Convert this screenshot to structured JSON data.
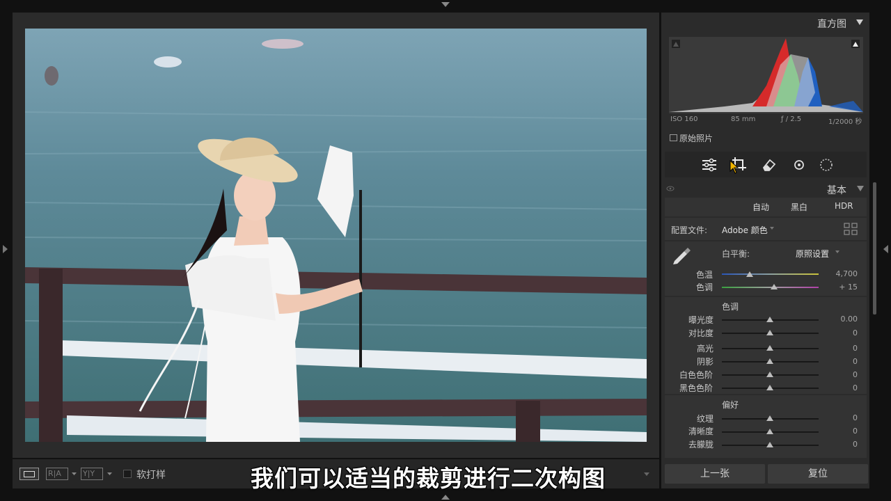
{
  "histogram": {
    "title": "直方图",
    "exif": {
      "iso": "ISO 160",
      "focal": "85 mm",
      "aperture": "ƒ / 2.5",
      "shutter": "1/2000 秒"
    },
    "original_photo_label": "原始照片"
  },
  "basic": {
    "title": "基本",
    "auto": "自动",
    "bw": "黑白",
    "hdr": "HDR",
    "profile_label": "配置文件:",
    "profile_value": "Adobe 颜色",
    "wb_label": "白平衡:",
    "wb_value": "原照设置",
    "temp_label": "色温",
    "temp_value": "4,700",
    "tint_label": "色调",
    "tint_value": "+ 15",
    "tone_header": "色调",
    "exposure_label": "曝光度",
    "exposure_value": "0.00",
    "contrast_label": "对比度",
    "contrast_value": "0",
    "highlights_label": "高光",
    "highlights_value": "0",
    "shadows_label": "阴影",
    "shadows_value": "0",
    "whites_label": "白色色阶",
    "whites_value": "0",
    "blacks_label": "黑色色阶",
    "blacks_value": "0",
    "presence_header": "偏好",
    "texture_label": "纹理",
    "texture_value": "0",
    "clarity_label": "清晰度",
    "clarity_value": "0",
    "dehaze_label": "去朦胧",
    "dehaze_value": "0"
  },
  "toolbar": {
    "soft_proof_label": "软打样",
    "view_ra": "R|A",
    "view_yy": "Y|Y"
  },
  "nav": {
    "prev_label": "上一张",
    "reset_label": "复位"
  },
  "subtitle": "我们可以适当的裁剪进行二次构图",
  "colors": {
    "panel": "#2b2b2b",
    "section": "#333333",
    "accent_red": "#d62a2a",
    "accent_green": "#2eae3a",
    "accent_blue": "#2060c0"
  }
}
